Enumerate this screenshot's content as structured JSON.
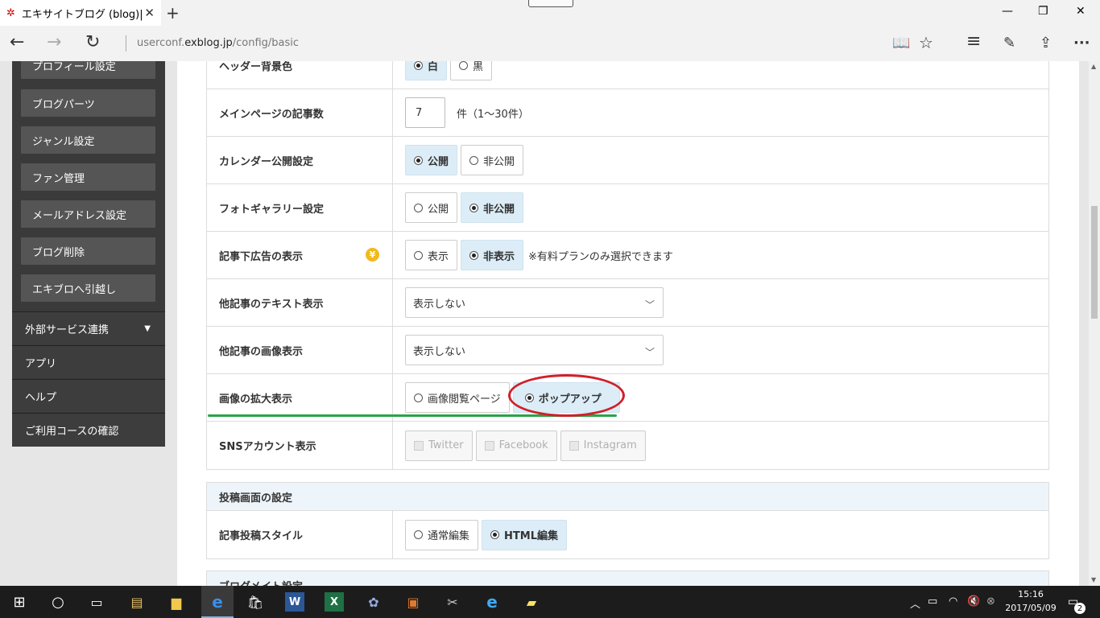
{
  "browser": {
    "tab_title": "エキサイトブログ (blog)|基本",
    "tab_close": "✕",
    "new_tab": "+",
    "minimize": "—",
    "restore": "❐",
    "close": "✕",
    "back": "←",
    "forward": "→",
    "refresh": "↻",
    "url_prefix": "userconf.",
    "url_host": "exblog.jp",
    "url_path": "/config/basic",
    "reading_view": "📖",
    "favorite": "☆",
    "hub": "≡",
    "web_note": "✎",
    "share": "⇪",
    "more": "···"
  },
  "sidebar": {
    "sub_items": [
      {
        "label": "プロフィール設定"
      },
      {
        "label": "ブログパーツ"
      },
      {
        "label": "ジャンル設定"
      },
      {
        "label": "ファン管理"
      },
      {
        "label": "メールアドレス設定"
      },
      {
        "label": "ブログ削除"
      },
      {
        "label": "エキブロへ引越し"
      }
    ],
    "main_items": [
      {
        "label": "外部サービス連携",
        "caret": "▼"
      },
      {
        "label": "アプリ"
      },
      {
        "label": "ヘルプ"
      },
      {
        "label": "ご利用コースの確認"
      }
    ]
  },
  "settings": {
    "header_bg": {
      "label": "ヘッダー背景色",
      "options": [
        "白",
        "黒"
      ],
      "selected": "白"
    },
    "main_count": {
      "label": "メインページの記事数",
      "value": "7",
      "suffix": "件（1〜30件）"
    },
    "calendar": {
      "label": "カレンダー公開設定",
      "options": [
        "公開",
        "非公開"
      ],
      "selected": "公開"
    },
    "photo_gallery": {
      "label": "フォトギャラリー設定",
      "options": [
        "公開",
        "非公開"
      ],
      "selected": "非公開"
    },
    "ad_display": {
      "label": "記事下広告の表示",
      "badge": "¥",
      "options": [
        "表示",
        "非表示"
      ],
      "selected": "非表示",
      "note": "※有料プランのみ選択できます"
    },
    "other_text": {
      "label": "他記事のテキスト表示",
      "value": "表示しない",
      "chevron": "﹀"
    },
    "other_image": {
      "label": "他記事の画像表示",
      "value": "表示しない",
      "chevron": "﹀"
    },
    "image_zoom": {
      "label": "画像の拡大表示",
      "options": [
        "画像閲覧ページ",
        "ポップアップ"
      ],
      "selected": "ポップアップ"
    },
    "sns": {
      "label": "SNSアカウント表示",
      "options": [
        "Twitter",
        "Facebook",
        "Instagram"
      ]
    }
  },
  "post_section": {
    "title": "投稿画面の設定",
    "style": {
      "label": "記事投稿スタイル",
      "options": [
        "通常編集",
        "HTML編集"
      ],
      "selected": "HTML編集"
    }
  },
  "next_section": {
    "title": "ブログメイト設定"
  },
  "taskbar": {
    "time": "15:16",
    "date": "2017/05/09",
    "notifications": "2",
    "colors": {
      "accent": "#7fb2e5",
      "annotation_green": "#2aa34a",
      "annotation_red": "#d0202a"
    }
  }
}
